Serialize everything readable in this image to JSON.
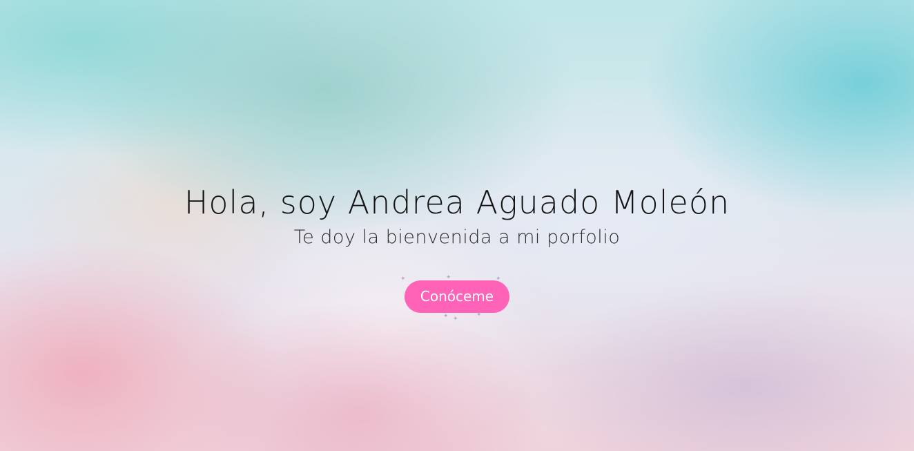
{
  "hero": {
    "title": "Hola, soy Andrea Aguado Moleón",
    "subtitle": "Te doy la bienvenida a mi porfolio",
    "cta_label": "Conóceme"
  },
  "colors": {
    "cta_background": "#ff63b8",
    "cta_text": "#ffffff",
    "title_text": "#141414"
  }
}
